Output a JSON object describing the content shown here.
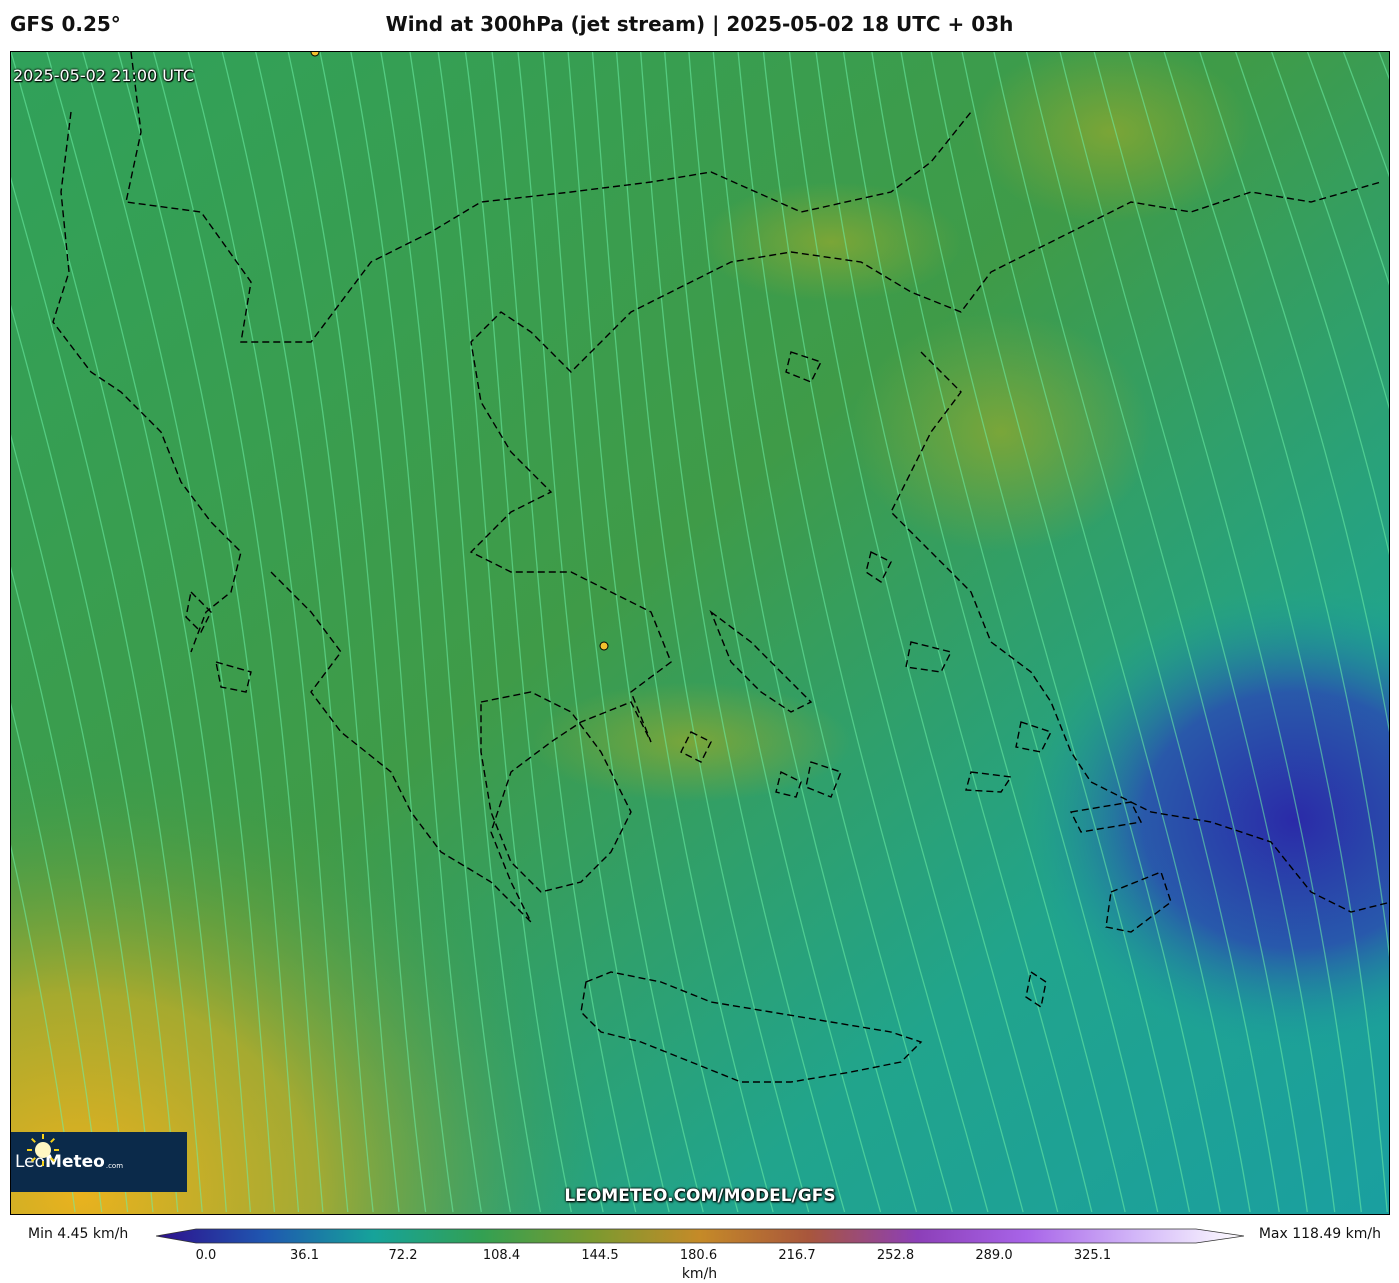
{
  "header": {
    "model": "GFS 0.25°",
    "title": "Wind at 300hPa (jet stream) | 2025-05-02 18 UTC + 03h"
  },
  "map": {
    "valid_time": "2025-05-02 21:00 UTC",
    "watermark": "LEOMETEO.COM/MODEL/GFS",
    "logo": {
      "brand_light": "Leo",
      "brand_bold": "Meteo",
      "suffix": ".com"
    },
    "field_colors": {
      "low": "#2a2aa8",
      "teal": "#17a39a",
      "green": "#3a9a4a",
      "yellow_green": "#7aa833",
      "yellow": "#e6b020"
    },
    "streamline_color": "#6ef0a8",
    "coastline_color": "#000000"
  },
  "colorbar": {
    "min_label": "Min 4.45 km/h",
    "max_label": "Max 118.49 km/h",
    "ticks": [
      "0.0",
      "36.1",
      "72.2",
      "108.4",
      "144.5",
      "180.6",
      "216.7",
      "252.8",
      "289.0",
      "325.1"
    ],
    "unit": "km/h",
    "colors": [
      "#2e0f8c",
      "#1f57b0",
      "#16a39a",
      "#33a052",
      "#7a9a30",
      "#c58a28",
      "#a8563c",
      "#8c3fb8",
      "#a864e8",
      "#d2b6f8",
      "#ffffff"
    ]
  }
}
